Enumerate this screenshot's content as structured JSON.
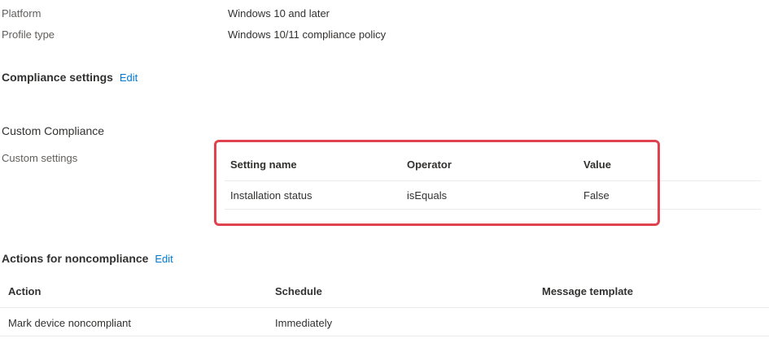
{
  "properties": [
    {
      "label": "Platform",
      "value": "Windows 10 and later"
    },
    {
      "label": "Profile type",
      "value": "Windows 10/11 compliance policy"
    }
  ],
  "compliance_settings": {
    "title": "Compliance settings",
    "edit_label": "Edit"
  },
  "custom_compliance": {
    "title": "Custom Compliance",
    "settings_label": "Custom settings",
    "table": {
      "headers": [
        "Setting name",
        "Operator",
        "Value"
      ],
      "rows": [
        [
          "Installation status",
          "isEquals",
          "False"
        ]
      ]
    }
  },
  "actions": {
    "title": "Actions for noncompliance",
    "edit_label": "Edit",
    "table": {
      "headers": [
        "Action",
        "Schedule",
        "Message template"
      ],
      "rows": [
        [
          "Mark device noncompliant",
          "Immediately",
          ""
        ]
      ]
    }
  },
  "colors": {
    "link": "#0078d4",
    "highlight_border": "#e0424f",
    "divider": "#edebe9"
  }
}
